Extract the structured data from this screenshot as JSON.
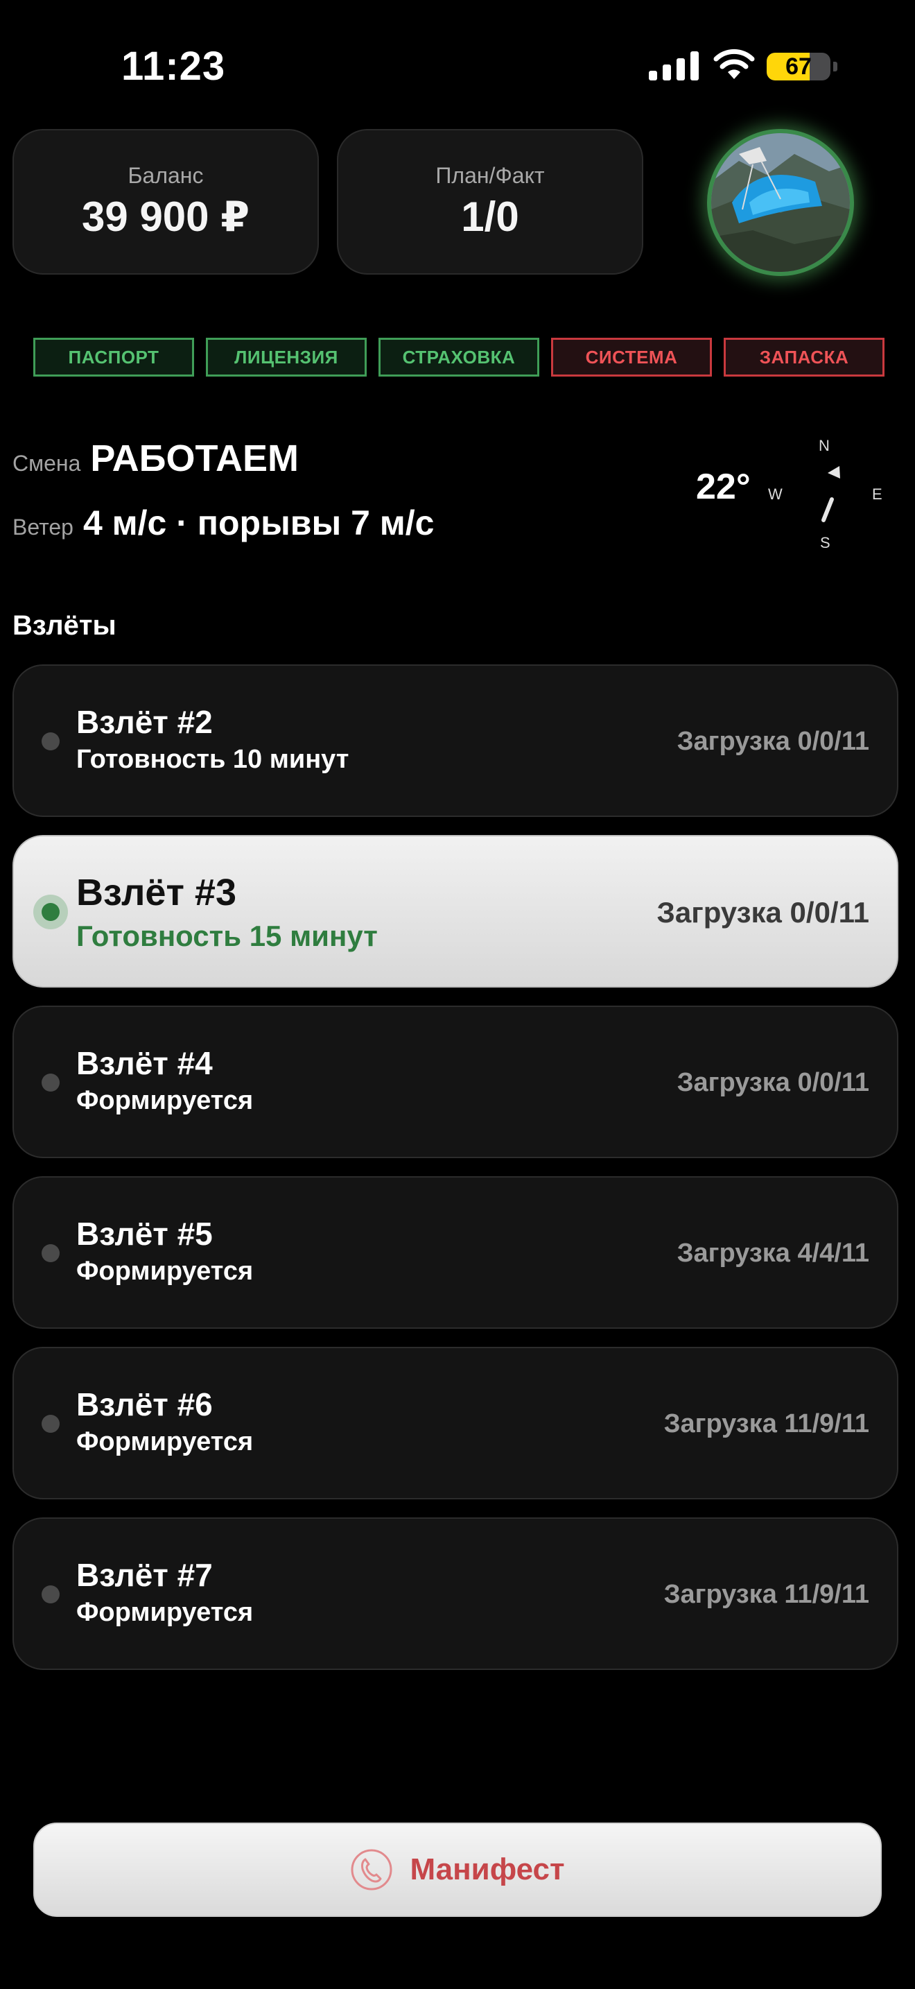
{
  "status_bar": {
    "time": "11:23",
    "battery_level": "67",
    "battery_percent": 67,
    "icons": [
      "signal-icon",
      "wifi-icon",
      "battery-icon"
    ]
  },
  "stats": {
    "balance": {
      "label": "Баланс",
      "value": "39 900 ₽"
    },
    "plan_fact": {
      "label": "План/Факт",
      "value": "1/0"
    }
  },
  "profile": {
    "avatar_icon": "paraglider-avatar",
    "ring_color": "#3a8a4a"
  },
  "documents": [
    {
      "label": "ПАСПОРТ",
      "status": "ok"
    },
    {
      "label": "ЛИЦЕНЗИЯ",
      "status": "ok"
    },
    {
      "label": "СТРАХОВКА",
      "status": "ok"
    },
    {
      "label": "СИСТЕМА",
      "status": "bad"
    },
    {
      "label": "ЗАПАСКА",
      "status": "bad"
    }
  ],
  "conditions": {
    "shift_label": "Смена",
    "shift_value": "РАБОТАЕМ",
    "wind_label": "Ветер",
    "wind_value": "4 м/с · порывы 7 м/с",
    "temperature": "22°",
    "compass": {
      "n": "N",
      "e": "E",
      "s": "S",
      "w": "W"
    }
  },
  "flights_section": {
    "title": "Взлёты",
    "items": [
      {
        "title": "Взлёт #2",
        "status": "Готовность 10 минут",
        "load": "Загрузка 0/0/11",
        "active": false
      },
      {
        "title": "Взлёт #3",
        "status": "Готовность 15 минут",
        "load": "Загрузка 0/0/11",
        "active": true
      },
      {
        "title": "Взлёт #4",
        "status": "Формируется",
        "load": "Загрузка 0/0/11",
        "active": false
      },
      {
        "title": "Взлёт #5",
        "status": "Формируется",
        "load": "Загрузка 4/4/11",
        "active": false
      },
      {
        "title": "Взлёт #6",
        "status": "Формируется",
        "load": "Загрузка 11/9/11",
        "active": false
      },
      {
        "title": "Взлёт #7",
        "status": "Формируется",
        "load": "Загрузка 11/9/11",
        "active": false
      }
    ]
  },
  "manifest_button": {
    "label": "Манифест",
    "icon": "phone-icon",
    "accent": "#c6464a"
  },
  "colors": {
    "ok": "#55c271",
    "bad": "#ef5357",
    "ready": "#2f7d3f",
    "battery": "#ffd60a"
  }
}
